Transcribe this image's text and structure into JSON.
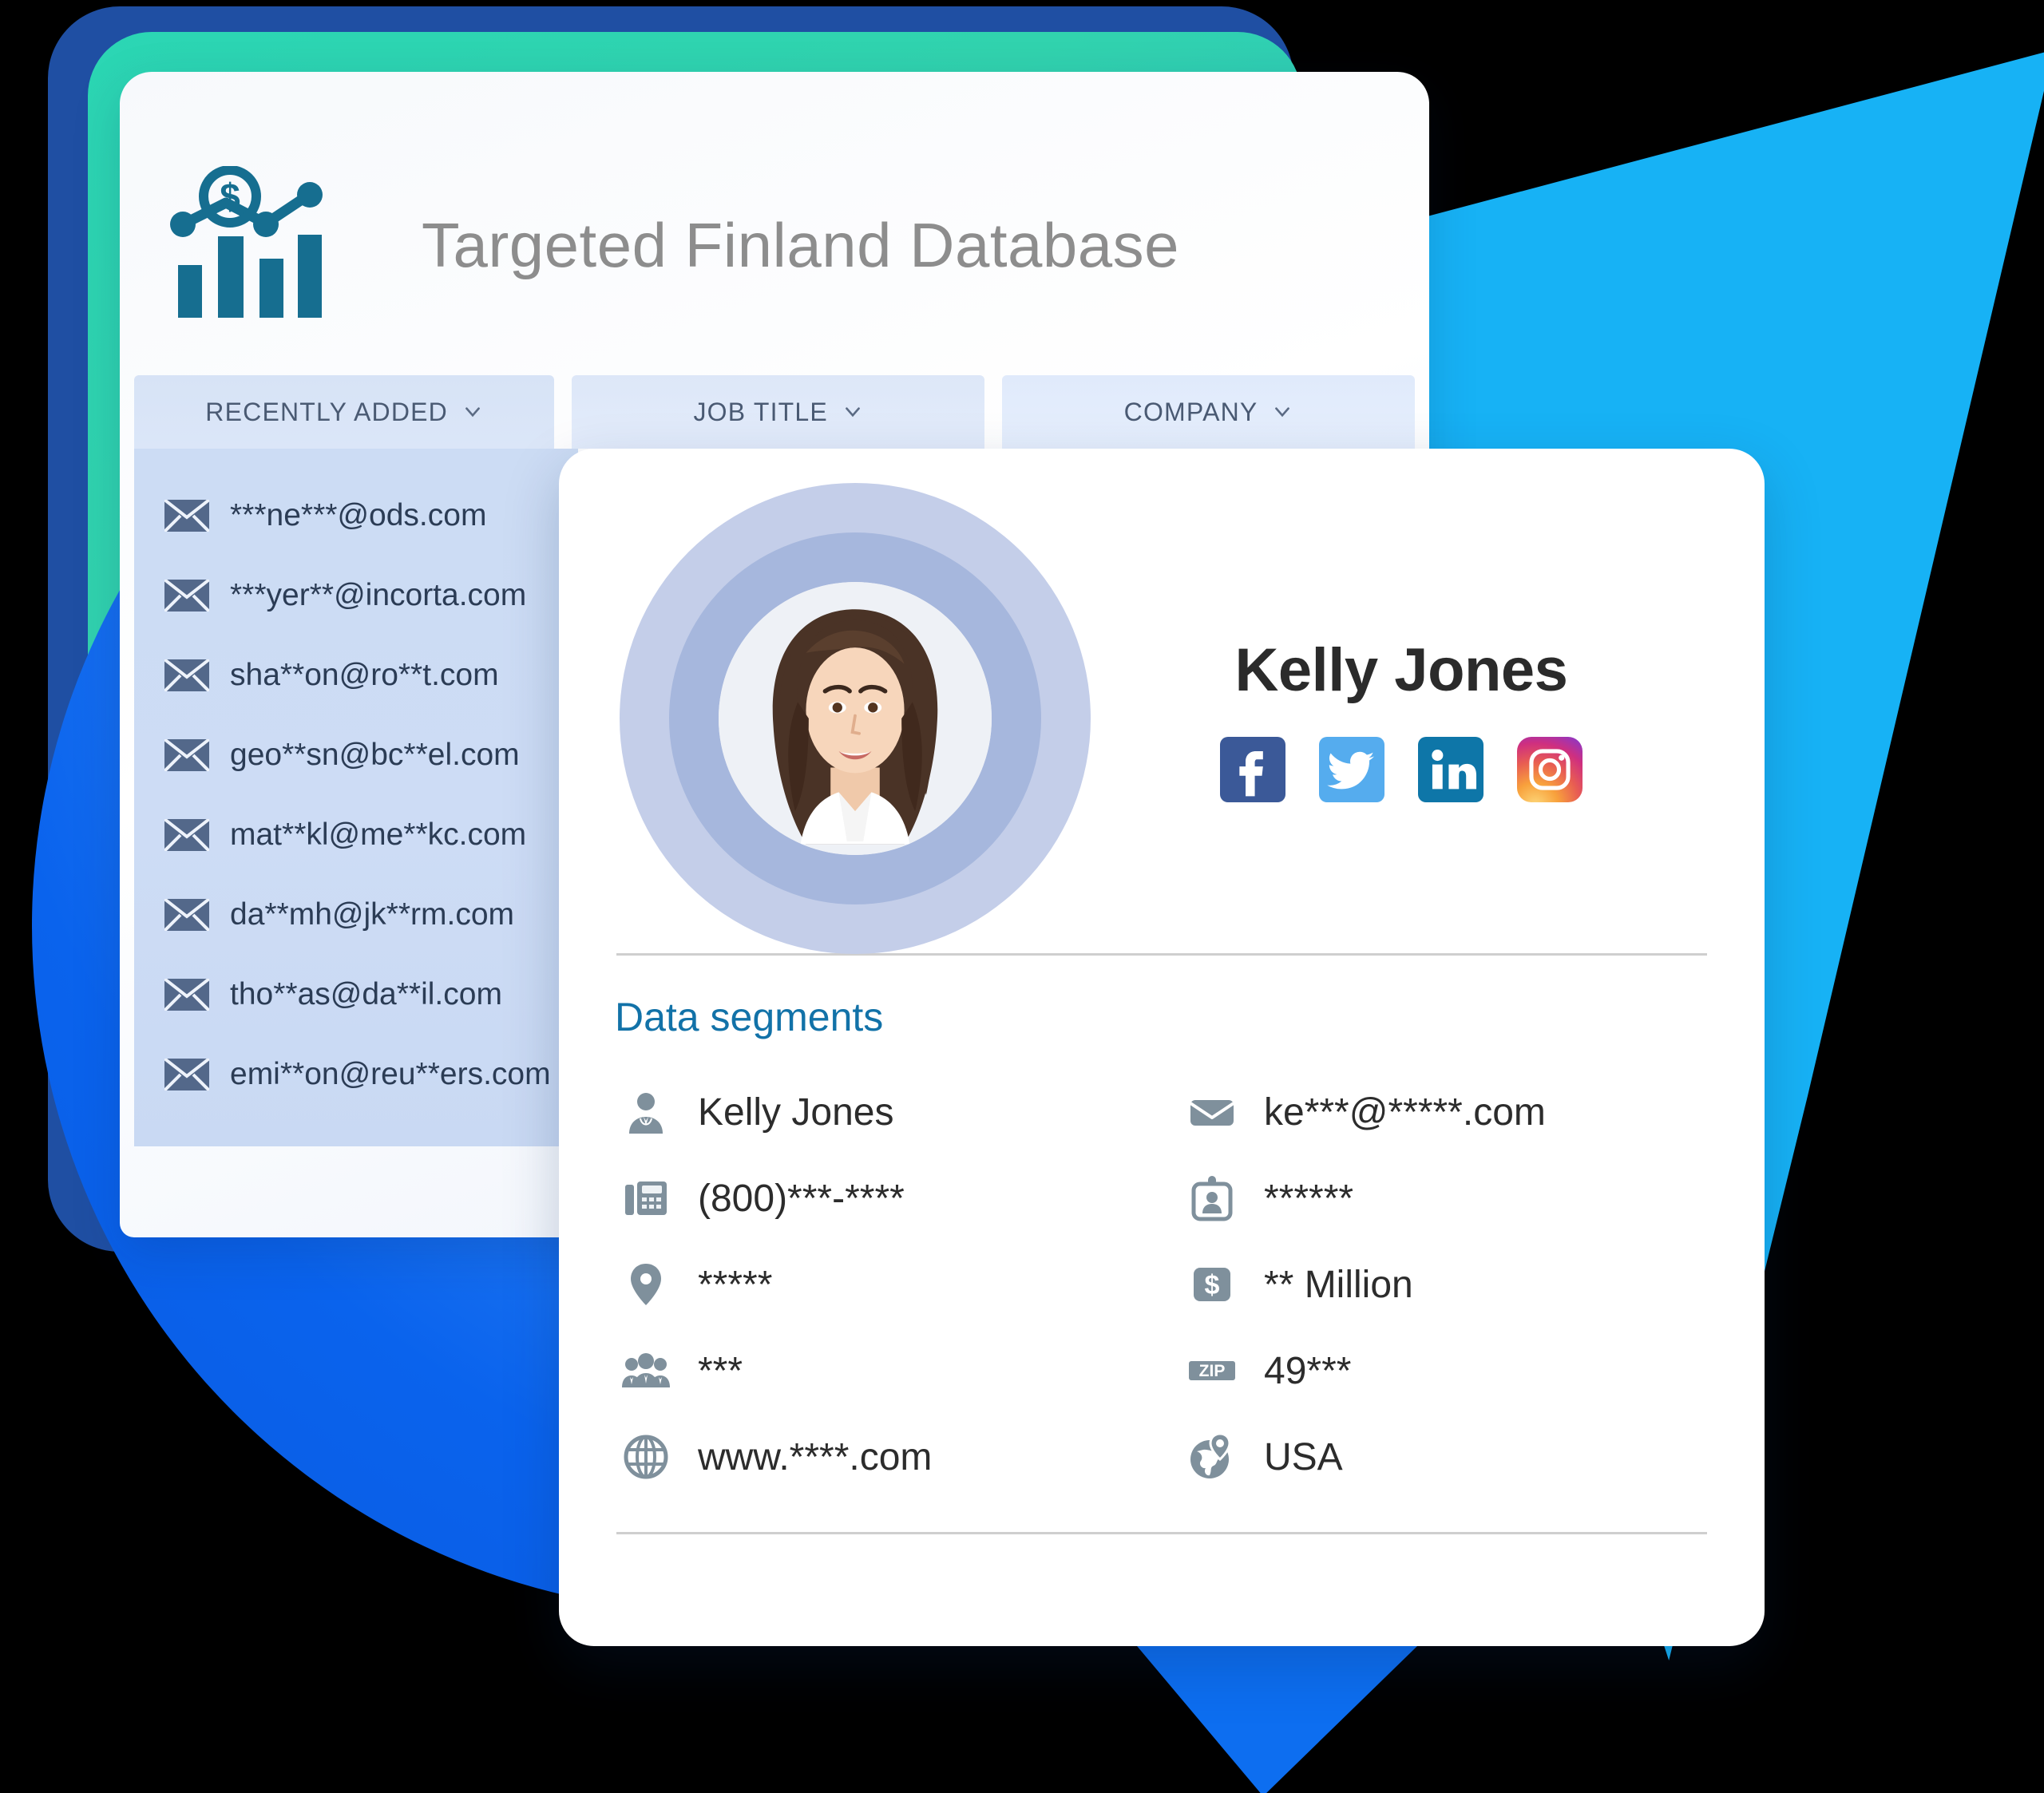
{
  "app": {
    "logo_icon": "bar-chart-dollar-logo",
    "title": "Targeted Finland Database"
  },
  "columns": [
    {
      "label": "RECENTLY ADDED",
      "chevron_icon": "chevron-down-icon"
    },
    {
      "label": "JOB TITLE",
      "chevron_icon": "chevron-down-icon"
    },
    {
      "label": "COMPANY",
      "chevron_icon": "chevron-down-icon"
    }
  ],
  "email_list": {
    "item_icon": "envelope-icon",
    "items": [
      "***ne***@ods.com",
      "***yer**@incorta.com",
      "sha**on@ro**t.com",
      "geo**sn@bc**el.com",
      "mat**kl@me**kc.com",
      "da**mh@jk**rm.com",
      "tho**as@da**il.com",
      "emi**on@reu**ers.com"
    ]
  },
  "profile": {
    "avatar_alt": "profile-photo",
    "name": "Kelly Jones",
    "socials": [
      {
        "name": "facebook-icon",
        "color": "#3b5998"
      },
      {
        "name": "twitter-icon",
        "color": "#55acee"
      },
      {
        "name": "linkedin-icon",
        "color": "#0e76a8"
      },
      {
        "name": "instagram-icon",
        "color": "#e1306c"
      }
    ],
    "segments_title": "Data segments",
    "segments": [
      {
        "icon": "person-icon",
        "value": "Kelly Jones"
      },
      {
        "icon": "envelope-icon",
        "value": "ke***@*****.com"
      },
      {
        "icon": "fax-phone-icon",
        "value": "(800)***-****"
      },
      {
        "icon": "id-badge-icon",
        "value": "******"
      },
      {
        "icon": "map-pin-icon",
        "value": "*****"
      },
      {
        "icon": "dollar-square-icon",
        "value": "** Million"
      },
      {
        "icon": "people-group-icon",
        "value": "***"
      },
      {
        "icon": "zip-icon",
        "value": "49***"
      },
      {
        "icon": "globe-icon",
        "value": "www.****.com"
      },
      {
        "icon": "globe-pin-icon",
        "value": "USA"
      }
    ]
  },
  "colors": {
    "brand_teal": "#2bd6b4",
    "brand_blue": "#0d6ef0",
    "cyan": "#17b2f5",
    "logo_teal": "#166e90",
    "title_gray": "#8d8d8d",
    "segment_link": "#1272a8",
    "icon_gray": "#7f909c"
  }
}
